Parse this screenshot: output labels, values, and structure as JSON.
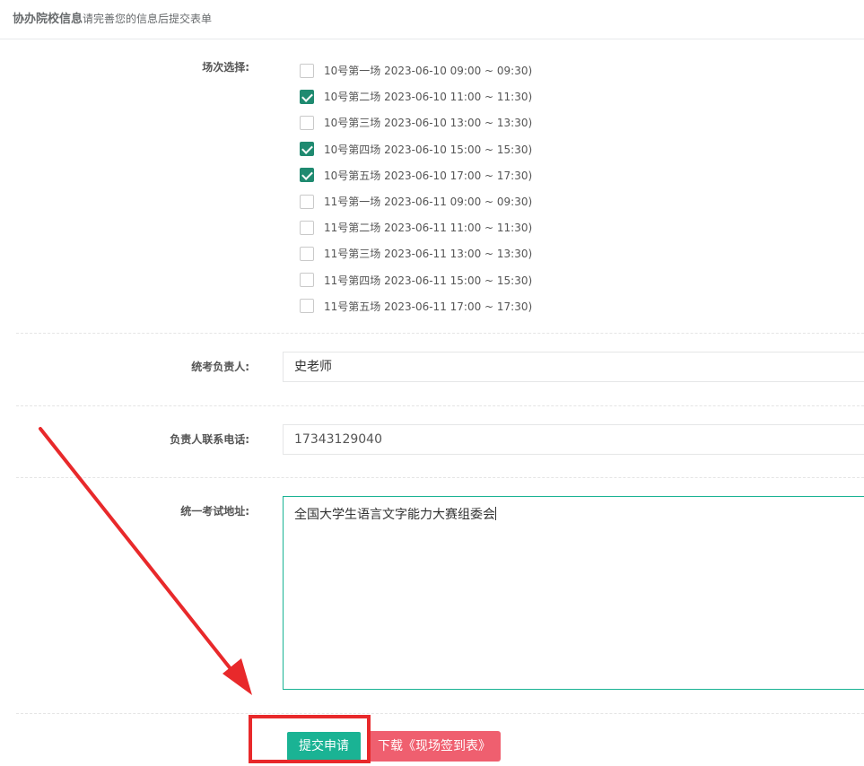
{
  "header": {
    "title": "协办院校信息",
    "subtitle": "请完善您的信息后提交表单"
  },
  "sessions": {
    "label": "场次选择:",
    "items": [
      {
        "text": "10号第一场 2023-06-10 09:00 ~ 09:30)",
        "checked": false
      },
      {
        "text": "10号第二场 2023-06-10 11:00 ~ 11:30)",
        "checked": true
      },
      {
        "text": "10号第三场 2023-06-10 13:00 ~ 13:30)",
        "checked": false
      },
      {
        "text": "10号第四场 2023-06-10 15:00 ~ 15:30)",
        "checked": true
      },
      {
        "text": "10号第五场 2023-06-10 17:00 ~ 17:30)",
        "checked": true
      },
      {
        "text": "11号第一场 2023-06-11 09:00 ~ 09:30)",
        "checked": false
      },
      {
        "text": "11号第二场 2023-06-11 11:00 ~ 11:30)",
        "checked": false
      },
      {
        "text": "11号第三场 2023-06-11 13:00 ~ 13:30)",
        "checked": false
      },
      {
        "text": "11号第四场 2023-06-11 15:00 ~ 15:30)",
        "checked": false
      },
      {
        "text": "11号第五场 2023-06-11 17:00 ~ 17:30)",
        "checked": false
      }
    ]
  },
  "manager": {
    "label": "统考负责人:",
    "value": "史老师"
  },
  "phone": {
    "label": "负责人联系电话:",
    "value": "17343129040"
  },
  "address": {
    "label": "统一考试地址:",
    "value": "全国大学生语言文字能力大赛组委会"
  },
  "actions": {
    "submit_label": "提交申请",
    "download_label": "下载《现场签到表》"
  },
  "colors": {
    "accent": "#1ab394",
    "checkbox_checked": "#1f8a70",
    "danger": "#ef5f6f",
    "annotation_red": "#e8292b"
  }
}
